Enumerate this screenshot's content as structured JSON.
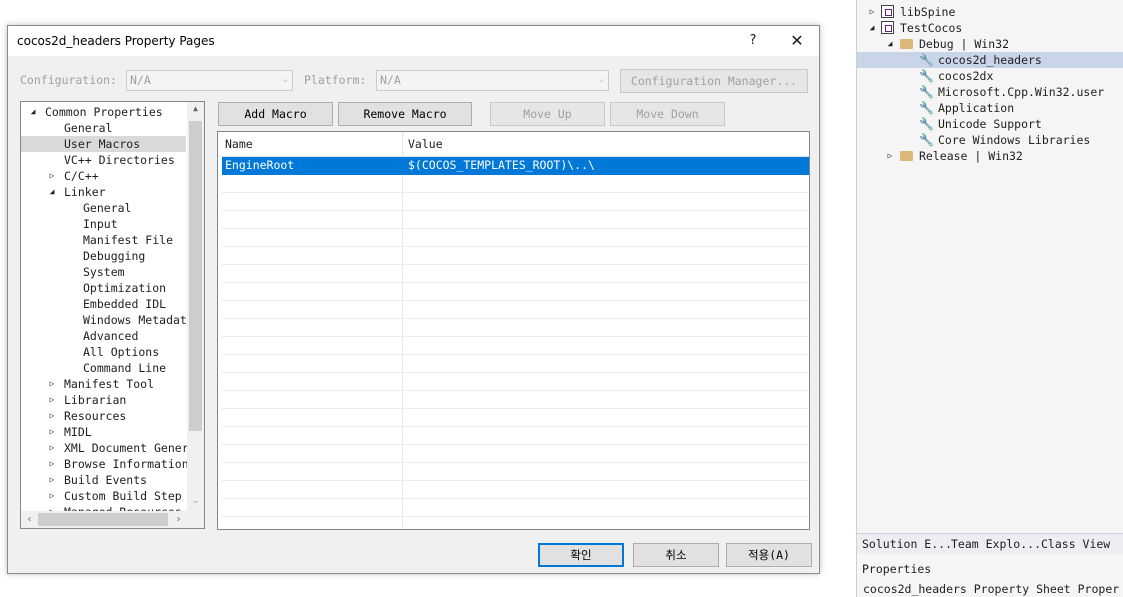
{
  "solution_tree": {
    "items": [
      {
        "label": "libSpine",
        "arrow": "▷",
        "icon": "project-icon"
      },
      {
        "label": "TestCocos",
        "arrow": "◢",
        "icon": "project-icon"
      },
      {
        "label": "Debug | Win32",
        "arrow": "◢",
        "icon": "folder-icon"
      },
      {
        "label": "cocos2d_headers",
        "icon": "wrench-icon"
      },
      {
        "label": "cocos2dx",
        "icon": "wrench-icon"
      },
      {
        "label": "Microsoft.Cpp.Win32.user",
        "icon": "wrench-icon"
      },
      {
        "label": "Application",
        "icon": "wrench-icon"
      },
      {
        "label": "Unicode Support",
        "icon": "wrench-icon"
      },
      {
        "label": "Core Windows Libraries",
        "icon": "wrench-icon"
      },
      {
        "label": "Release | Win32",
        "arrow": "▷",
        "icon": "folder-icon"
      }
    ]
  },
  "vs_tabs": [
    "Solution E...",
    "Team Explo...",
    "Class View"
  ],
  "vs_properties": {
    "header": "Properties",
    "object": "cocos2d_headers Property Sheet Proper"
  },
  "dialog": {
    "title": "cocos2d_headers Property Pages",
    "help": "?",
    "close": "✕",
    "configuration_label": "Configuration:",
    "configuration_value": "N/A",
    "platform_label": "Platform:",
    "platform_value": "N/A",
    "config_manager": "Configuration Manager...",
    "add_macro": "Add Macro",
    "remove_macro": "Remove Macro",
    "move_up": "Move Up",
    "move_down": "Move Down",
    "ok": "확인",
    "cancel": "취소",
    "apply": "적용(A)"
  },
  "prop_tree": {
    "items": [
      {
        "label": "Common Properties",
        "arrow": "◢"
      },
      {
        "label": "General"
      },
      {
        "label": "User Macros"
      },
      {
        "label": "VC++ Directories"
      },
      {
        "label": "C/C++",
        "arrow": "▷"
      },
      {
        "label": "Linker",
        "arrow": "◢"
      },
      {
        "label": "General"
      },
      {
        "label": "Input"
      },
      {
        "label": "Manifest File"
      },
      {
        "label": "Debugging"
      },
      {
        "label": "System"
      },
      {
        "label": "Optimization"
      },
      {
        "label": "Embedded IDL"
      },
      {
        "label": "Windows Metadat"
      },
      {
        "label": "Advanced"
      },
      {
        "label": "All Options"
      },
      {
        "label": "Command Line"
      },
      {
        "label": "Manifest Tool",
        "arrow": "▷"
      },
      {
        "label": "Librarian",
        "arrow": "▷"
      },
      {
        "label": "Resources",
        "arrow": "▷"
      },
      {
        "label": "MIDL",
        "arrow": "▷"
      },
      {
        "label": "XML Document Gener",
        "arrow": "▷"
      },
      {
        "label": "Browse Information",
        "arrow": "▷"
      },
      {
        "label": "Build Events",
        "arrow": "▷"
      },
      {
        "label": "Custom Build Step",
        "arrow": "▷"
      },
      {
        "label": "Managed Resources",
        "arrow": "▷"
      }
    ]
  },
  "grid": {
    "headers": [
      "Name",
      "Value"
    ],
    "rows": [
      {
        "name": "EngineRoot",
        "value": "$(COCOS_TEMPLATES_ROOT)\\..\\"
      }
    ]
  }
}
